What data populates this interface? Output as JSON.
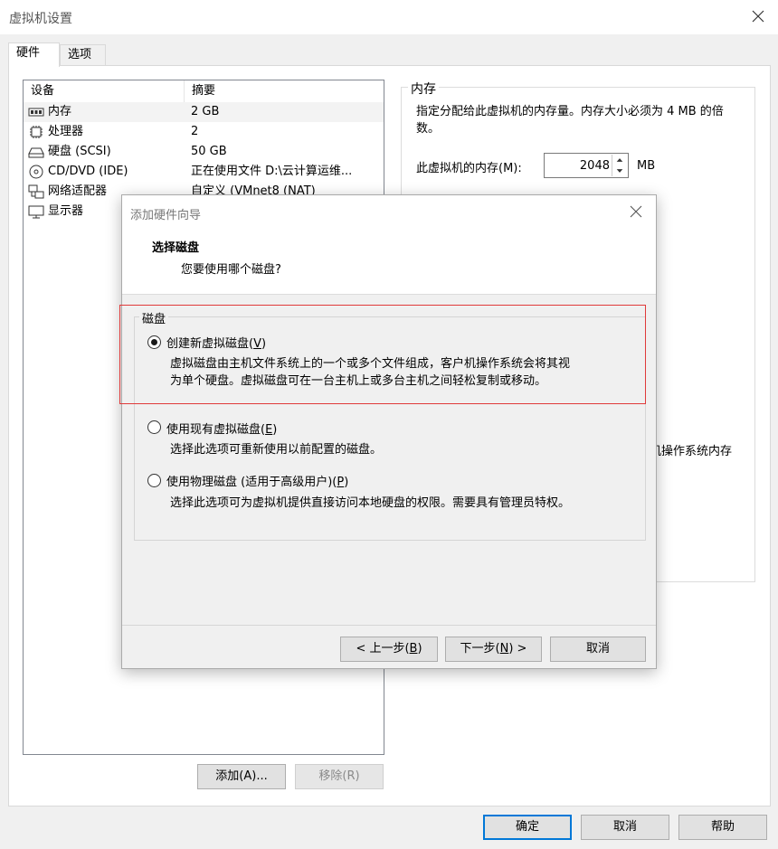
{
  "window": {
    "title": "虚拟机设置",
    "tabs": [
      "硬件",
      "选项"
    ]
  },
  "device_list": {
    "columns": [
      "设备",
      "摘要"
    ],
    "rows": [
      {
        "icon": "memory-icon",
        "name": "内存",
        "summary": "2 GB"
      },
      {
        "icon": "cpu-icon",
        "name": "处理器",
        "summary": "2"
      },
      {
        "icon": "hard-disk-icon",
        "name": "硬盘 (SCSI)",
        "summary": "50 GB"
      },
      {
        "icon": "cd-dvd-icon",
        "name": "CD/DVD (IDE)",
        "summary": "正在使用文件 D:\\云计算运维..."
      },
      {
        "icon": "network-adapter-icon",
        "name": "网络适配器",
        "summary": "自定义 (VMnet8 (NAT)"
      },
      {
        "icon": "display-icon",
        "name": "显示器",
        "summary": ""
      }
    ]
  },
  "memory_panel": {
    "legend": "内存",
    "description": "指定分配给此虚拟机的内存量。内存大小必须为 4 MB 的倍数。",
    "label": "此虚拟机的内存(M):",
    "value": "2048",
    "unit": "MB",
    "fragment": "机操作系统内存"
  },
  "buttons": {
    "add": "添加(A)...",
    "remove": "移除(R)",
    "ok": "确定",
    "cancel": "取消",
    "help": "帮助"
  },
  "wizard": {
    "title": "添加硬件向导",
    "heading": "选择磁盘",
    "subheading": "您要使用哪个磁盘?",
    "group_label": "磁盘",
    "options": [
      {
        "label": "创建新虚拟磁盘(",
        "key": "V",
        "suffix": ")",
        "checked": true,
        "desc1": "虚拟磁盘由主机文件系统上的一个或多个文件组成，客户机操作系统会将其视",
        "desc2": "为单个硬盘。虚拟磁盘可在一台主机上或多台主机之间轻松复制或移动。"
      },
      {
        "label": "使用现有虚拟磁盘(",
        "key": "E",
        "suffix": ")",
        "checked": false,
        "desc1": "选择此选项可重新使用以前配置的磁盘。"
      },
      {
        "label": "使用物理磁盘 (适用于高级用户)(",
        "key": "P",
        "suffix": ")",
        "checked": false,
        "desc1": "选择此选项可为虚拟机提供直接访问本地硬盘的权限。需要具有管理员特权。"
      }
    ],
    "back": {
      "pre": "< 上一步(",
      "key": "B",
      "post": ")"
    },
    "next": {
      "pre": "下一步(",
      "key": "N",
      "post": ") >"
    },
    "cancel": "取消"
  },
  "colors": {
    "accent": "#0078d7",
    "highlight": "#e03a3a"
  }
}
